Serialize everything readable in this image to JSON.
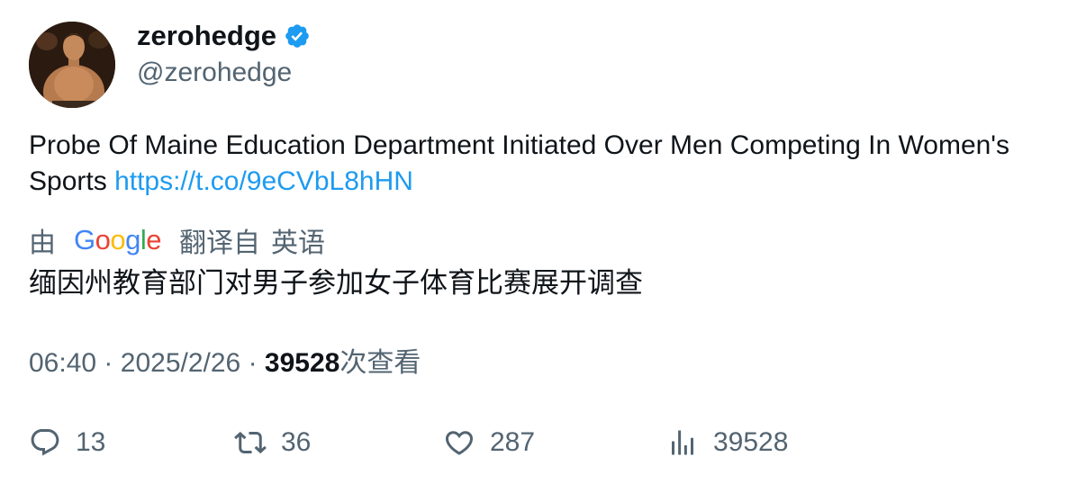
{
  "author": {
    "display_name": "zerohedge",
    "handle": "@zerohedge",
    "verified": true,
    "avatar_icon": "profile-photo",
    "verified_color": "#1d9bf0"
  },
  "tweet": {
    "text": "Probe Of Maine Education Department Initiated Over Men Competing In Women's Sports",
    "link": "https://t.co/9eCVbL8hHN",
    "link_color": "#1d9bf0"
  },
  "translation": {
    "prefix": "由",
    "provider": "Google",
    "suffix": "翻译自",
    "source_language": "英语",
    "text": "缅因州教育部门对男子参加女子体育比赛展开调查"
  },
  "meta": {
    "time": "06:40",
    "separator": "·",
    "date": "2025/2/26",
    "views_count": "39528",
    "views_label": "次查看"
  },
  "actions": {
    "reply": {
      "icon": "reply-icon",
      "count": "13"
    },
    "retweet": {
      "icon": "retweet-icon",
      "count": "36"
    },
    "like": {
      "icon": "heart-icon",
      "count": "287"
    },
    "views": {
      "icon": "analytics-icon",
      "count": "39528"
    }
  }
}
